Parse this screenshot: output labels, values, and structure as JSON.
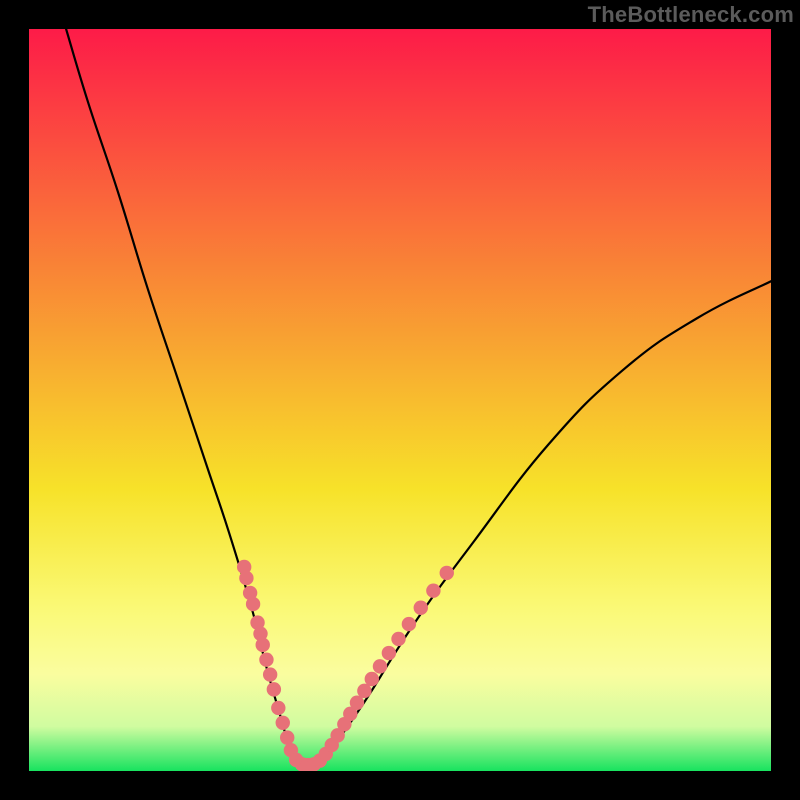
{
  "watermark": "TheBottleneck.com",
  "colors": {
    "gradient_top": "#fd1b48",
    "gradient_mid_upper": "#f98336",
    "gradient_mid": "#f7e229",
    "gradient_lower1": "#faf976",
    "gradient_lower2": "#fafd9f",
    "gradient_lower3": "#d0fca0",
    "gradient_bottom": "#18e35f",
    "curve": "#000000",
    "dots": "#e77178",
    "frame": "#000000"
  },
  "chart_data": {
    "type": "line",
    "title": "",
    "xlabel": "",
    "ylabel": "",
    "xlim": [
      0,
      100
    ],
    "ylim": [
      0,
      100
    ],
    "series": [
      {
        "name": "bottleneck-curve",
        "x": [
          5,
          8,
          12,
          16,
          20,
          24,
          27,
          30,
          32,
          34,
          35.5,
          37,
          38.5,
          40,
          45,
          52,
          60,
          70,
          80,
          90,
          100
        ],
        "y": [
          100,
          90,
          78,
          65,
          53,
          41,
          32,
          22,
          14,
          7,
          2,
          0.5,
          0.5,
          2,
          9,
          20,
          31,
          44,
          54,
          61,
          66
        ]
      }
    ],
    "marker_clusters": [
      {
        "cluster": "left-arm",
        "points_xy": [
          [
            29.0,
            27.5
          ],
          [
            29.3,
            26.0
          ],
          [
            29.8,
            24.0
          ],
          [
            30.2,
            22.5
          ],
          [
            30.8,
            20.0
          ],
          [
            31.2,
            18.5
          ],
          [
            31.5,
            17.0
          ],
          [
            32.0,
            15.0
          ],
          [
            32.5,
            13.0
          ],
          [
            33.0,
            11.0
          ],
          [
            33.6,
            8.5
          ],
          [
            34.2,
            6.5
          ],
          [
            34.8,
            4.5
          ]
        ]
      },
      {
        "cluster": "valley",
        "points_xy": [
          [
            35.3,
            2.8
          ],
          [
            36.0,
            1.5
          ],
          [
            36.8,
            0.9
          ],
          [
            37.6,
            0.8
          ],
          [
            38.4,
            0.9
          ],
          [
            39.2,
            1.4
          ],
          [
            40.0,
            2.3
          ]
        ]
      },
      {
        "cluster": "right-arm",
        "points_xy": [
          [
            40.8,
            3.5
          ],
          [
            41.6,
            4.8
          ],
          [
            42.5,
            6.3
          ],
          [
            43.3,
            7.7
          ],
          [
            44.2,
            9.2
          ],
          [
            45.2,
            10.8
          ],
          [
            46.2,
            12.4
          ],
          [
            47.3,
            14.1
          ],
          [
            48.5,
            15.9
          ],
          [
            49.8,
            17.8
          ],
          [
            51.2,
            19.8
          ],
          [
            52.8,
            22.0
          ],
          [
            54.5,
            24.3
          ],
          [
            56.3,
            26.7
          ]
        ]
      }
    ]
  }
}
